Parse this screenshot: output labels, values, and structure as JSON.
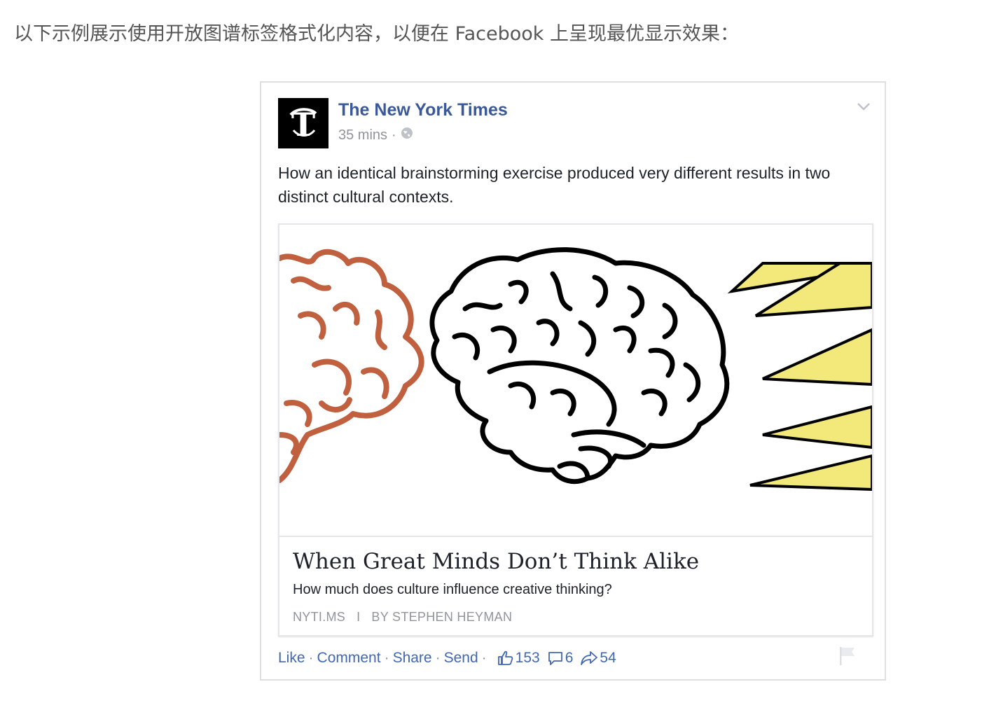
{
  "intro_text": "以下示例展示使用开放图谱标签格式化内容，以便在 Facebook 上呈现最优显示效果：",
  "post": {
    "page_name": "The New York Times",
    "time": "35 mins",
    "meta_separator": "·",
    "privacy_icon": "globe-icon",
    "avatar_icon": "nyt-logo-icon",
    "text": "How an identical brainstorming exercise produced very different results in two distinct cultural contexts.",
    "link": {
      "image_icon": "brain-illustration",
      "title": "When Great Minds Don’t Think Alike",
      "description": "How much does culture influence creative thinking?",
      "domain": "NYTI.MS",
      "separator": "I",
      "byline": "BY STEPHEN HEYMAN"
    },
    "actions": {
      "like": "Like",
      "comment": "Comment",
      "share": "Share",
      "send": "Send",
      "separator": "·",
      "like_count": "153",
      "comment_count": "6",
      "share_count": "54"
    }
  },
  "colors": {
    "link_blue": "#3b5998",
    "action_blue": "#4267b2",
    "meta_gray": "#90949c",
    "brain_left": "#c0603f",
    "spike_yellow": "#f3e97a"
  }
}
